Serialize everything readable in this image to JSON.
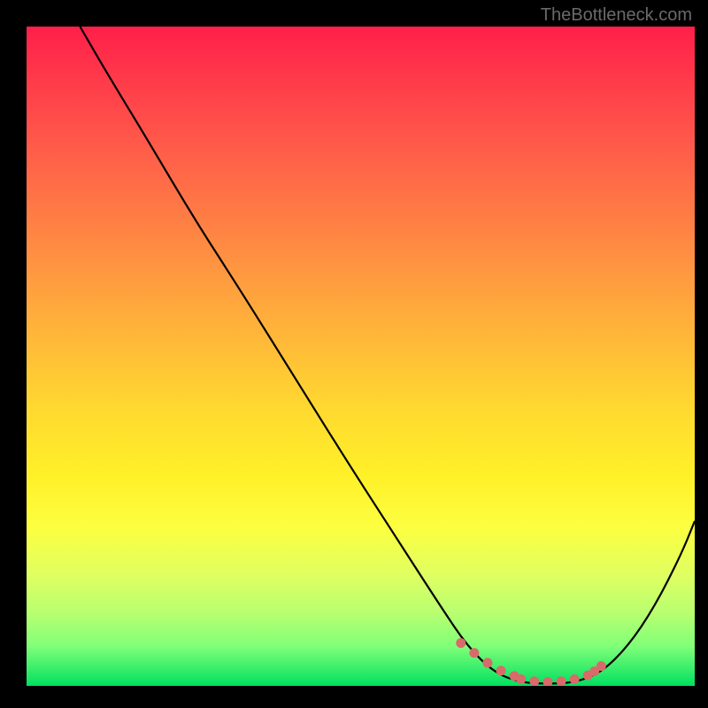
{
  "watermark": "TheBottleneck.com",
  "chart_data": {
    "type": "line",
    "title": "",
    "xlabel": "",
    "ylabel": "",
    "xlim": [
      0,
      100
    ],
    "ylim": [
      0,
      100
    ],
    "series": [
      {
        "name": "curve",
        "x": [
          8,
          12,
          18,
          25,
          32,
          40,
          48,
          55,
          62,
          66,
          70,
          74,
          78,
          82,
          86,
          90,
          94,
          98,
          100
        ],
        "y": [
          100,
          93,
          83,
          71,
          60,
          47,
          34,
          23,
          12,
          6,
          2,
          0.5,
          0.3,
          0.5,
          2,
          6,
          12,
          20,
          25
        ]
      }
    ],
    "markers": {
      "name": "highlight-dots",
      "x": [
        65,
        67,
        69,
        71,
        73,
        74,
        76,
        78,
        80,
        82,
        84,
        85,
        86
      ],
      "y": [
        6.5,
        5,
        3.5,
        2.3,
        1.5,
        1.0,
        0.7,
        0.6,
        0.7,
        1.0,
        1.6,
        2.2,
        3.0
      ]
    },
    "colors": {
      "curve": "#000000",
      "markers": "#d86a6a",
      "background_top": "#ff1f4a",
      "background_bottom": "#00e060"
    }
  }
}
